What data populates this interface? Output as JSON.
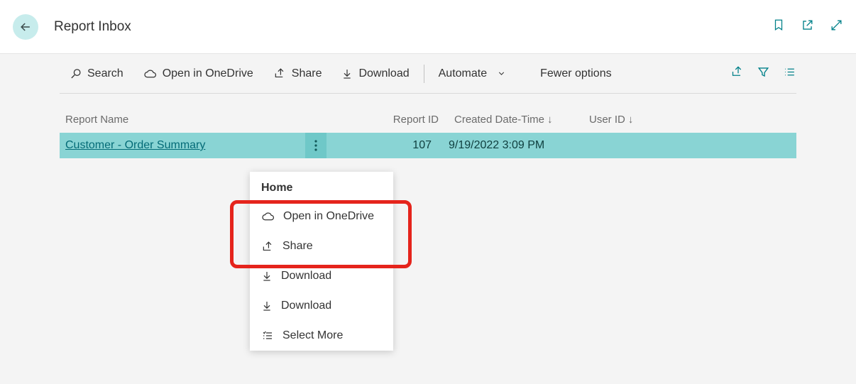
{
  "header": {
    "title": "Report Inbox"
  },
  "actions": {
    "search": "Search",
    "open_onedrive": "Open in OneDrive",
    "share": "Share",
    "download": "Download",
    "automate": "Automate",
    "fewer": "Fewer options"
  },
  "columns": {
    "name": "Report Name",
    "id": "Report ID",
    "date": "Created Date-Time",
    "user": "User ID"
  },
  "rows": [
    {
      "name": "Customer - Order Summary",
      "id": "107",
      "date": "9/19/2022 3:09 PM",
      "user": ""
    }
  ],
  "context_menu": {
    "header": "Home",
    "items": {
      "open_onedrive": "Open in OneDrive",
      "share": "Share",
      "download1": "Download",
      "download2": "Download",
      "select_more": "Select More"
    }
  }
}
